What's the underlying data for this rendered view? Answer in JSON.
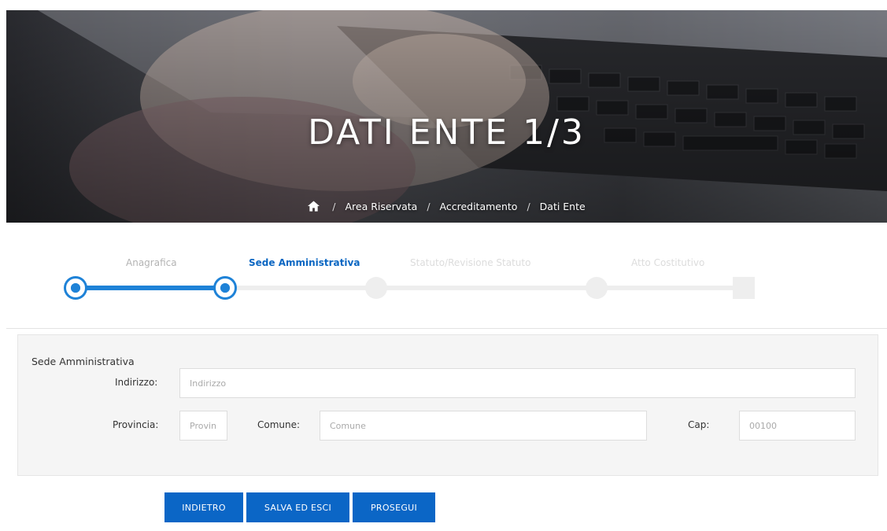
{
  "hero": {
    "title": "DATI ENTE 1/3",
    "breadcrumb": {
      "home_icon": "home-icon",
      "separator": "/",
      "items": [
        "Area Riservata",
        "Accreditamento",
        "Dati Ente"
      ]
    }
  },
  "stepper": {
    "steps": [
      {
        "label": "Anagrafica",
        "state": "done"
      },
      {
        "label": "Sede Amministrativa",
        "state": "current"
      },
      {
        "label": "Statuto/Revisione Statuto",
        "state": "pending"
      },
      {
        "label": "Atto Costitutivo",
        "state": "pending"
      }
    ],
    "accent_color": "#1e82d7"
  },
  "form": {
    "section_title": "Sede Amministrativa",
    "indirizzo": {
      "label": "Indirizzo:",
      "placeholder": "Indirizzo",
      "value": ""
    },
    "provincia": {
      "label": "Provincia:",
      "placeholder": "Provin",
      "value": ""
    },
    "comune": {
      "label": "Comune:",
      "placeholder": "Comune",
      "value": ""
    },
    "cap": {
      "label": "Cap:",
      "placeholder": "00100",
      "value": ""
    }
  },
  "actions": {
    "back_label": "INDIETRO",
    "save_exit_label": "SALVA ED ESCI",
    "next_label": "PROSEGUI",
    "button_color": "#0b66c6"
  }
}
